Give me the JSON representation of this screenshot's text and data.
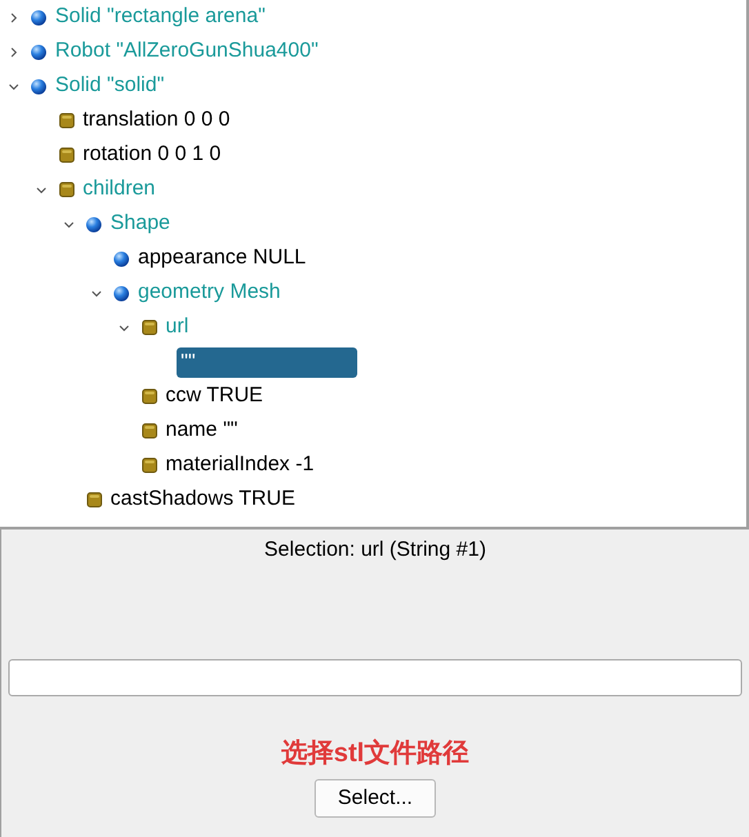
{
  "tree": [
    {
      "kind": "node",
      "label": "Solid \"rectangle arena\"",
      "expanded": false,
      "selected": false
    },
    {
      "kind": "node",
      "label": "Robot \"AllZeroGunShua400\"",
      "expanded": false,
      "selected": false
    },
    {
      "kind": "node",
      "label": "Solid \"solid\"",
      "expanded": true,
      "selected": false,
      "children": [
        {
          "kind": "field",
          "label": "translation 0 0 0",
          "selected": false
        },
        {
          "kind": "field",
          "label": "rotation 0 0 1 0",
          "selected": false
        },
        {
          "kind": "field",
          "label": "children",
          "expanded": true,
          "selected": false,
          "children": [
            {
              "kind": "node",
              "label": "Shape",
              "expanded": true,
              "selected": false,
              "children": [
                {
                  "kind": "node",
                  "label": "appearance NULL",
                  "selected": false
                },
                {
                  "kind": "node",
                  "label": "geometry Mesh",
                  "expanded": true,
                  "selected": false,
                  "children": [
                    {
                      "kind": "field",
                      "label": "url",
                      "expanded": true,
                      "selected": false,
                      "children": [
                        {
                          "label": "\"\"",
                          "selected": true
                        }
                      ]
                    },
                    {
                      "kind": "field",
                      "label": "ccw TRUE",
                      "selected": false
                    },
                    {
                      "kind": "field",
                      "label": "name \"\"",
                      "selected": false
                    },
                    {
                      "kind": "field",
                      "label": "materialIndex -1",
                      "selected": false
                    }
                  ]
                }
              ]
            },
            {
              "kind": "field",
              "label": "castShadows TRUE",
              "selected": false
            }
          ]
        }
      ]
    }
  ],
  "selection_label": "Selection: url (String #1)",
  "hint": "选择stl文件路径",
  "select_button": "Select..."
}
